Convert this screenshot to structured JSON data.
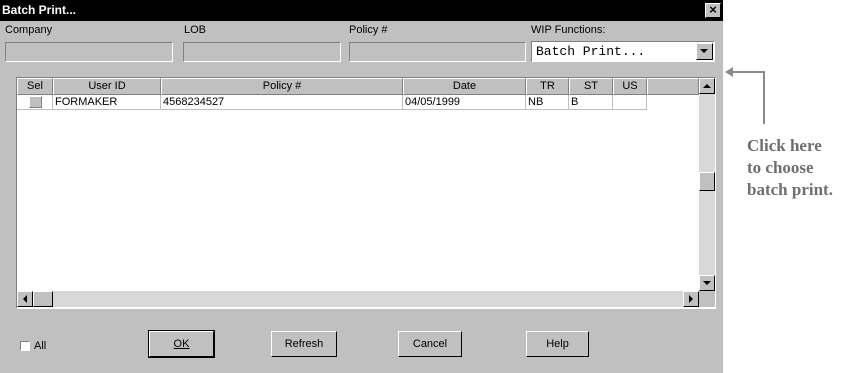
{
  "window": {
    "title": "Batch Print...",
    "close_glyph": "×"
  },
  "fields": {
    "company_label": "Company",
    "lob_label": "LOB",
    "policy_label": "Policy #",
    "wip_label": "WIP Functions:",
    "wip_value": "Batch Print..."
  },
  "table": {
    "headers": [
      "Sel",
      "User ID",
      "Policy #",
      "Date",
      "TR",
      "ST",
      "US"
    ],
    "rows": [
      {
        "sel": false,
        "user_id": "FORMAKER",
        "policy": "4568234527",
        "date": "04/05/1999",
        "tr": "NB",
        "st": "B",
        "us": ""
      }
    ]
  },
  "footer": {
    "all_label": "All",
    "ok_label": "OK",
    "refresh_label": "Refresh",
    "cancel_label": "Cancel",
    "help_label": "Help"
  },
  "callout": {
    "line1": "Click here",
    "line2": "to choose",
    "line3": "batch print."
  },
  "icons": [
    "close-icon",
    "chevron-down-icon",
    "arrow-up-icon",
    "arrow-down-icon",
    "arrow-left-icon",
    "arrow-right-icon"
  ]
}
